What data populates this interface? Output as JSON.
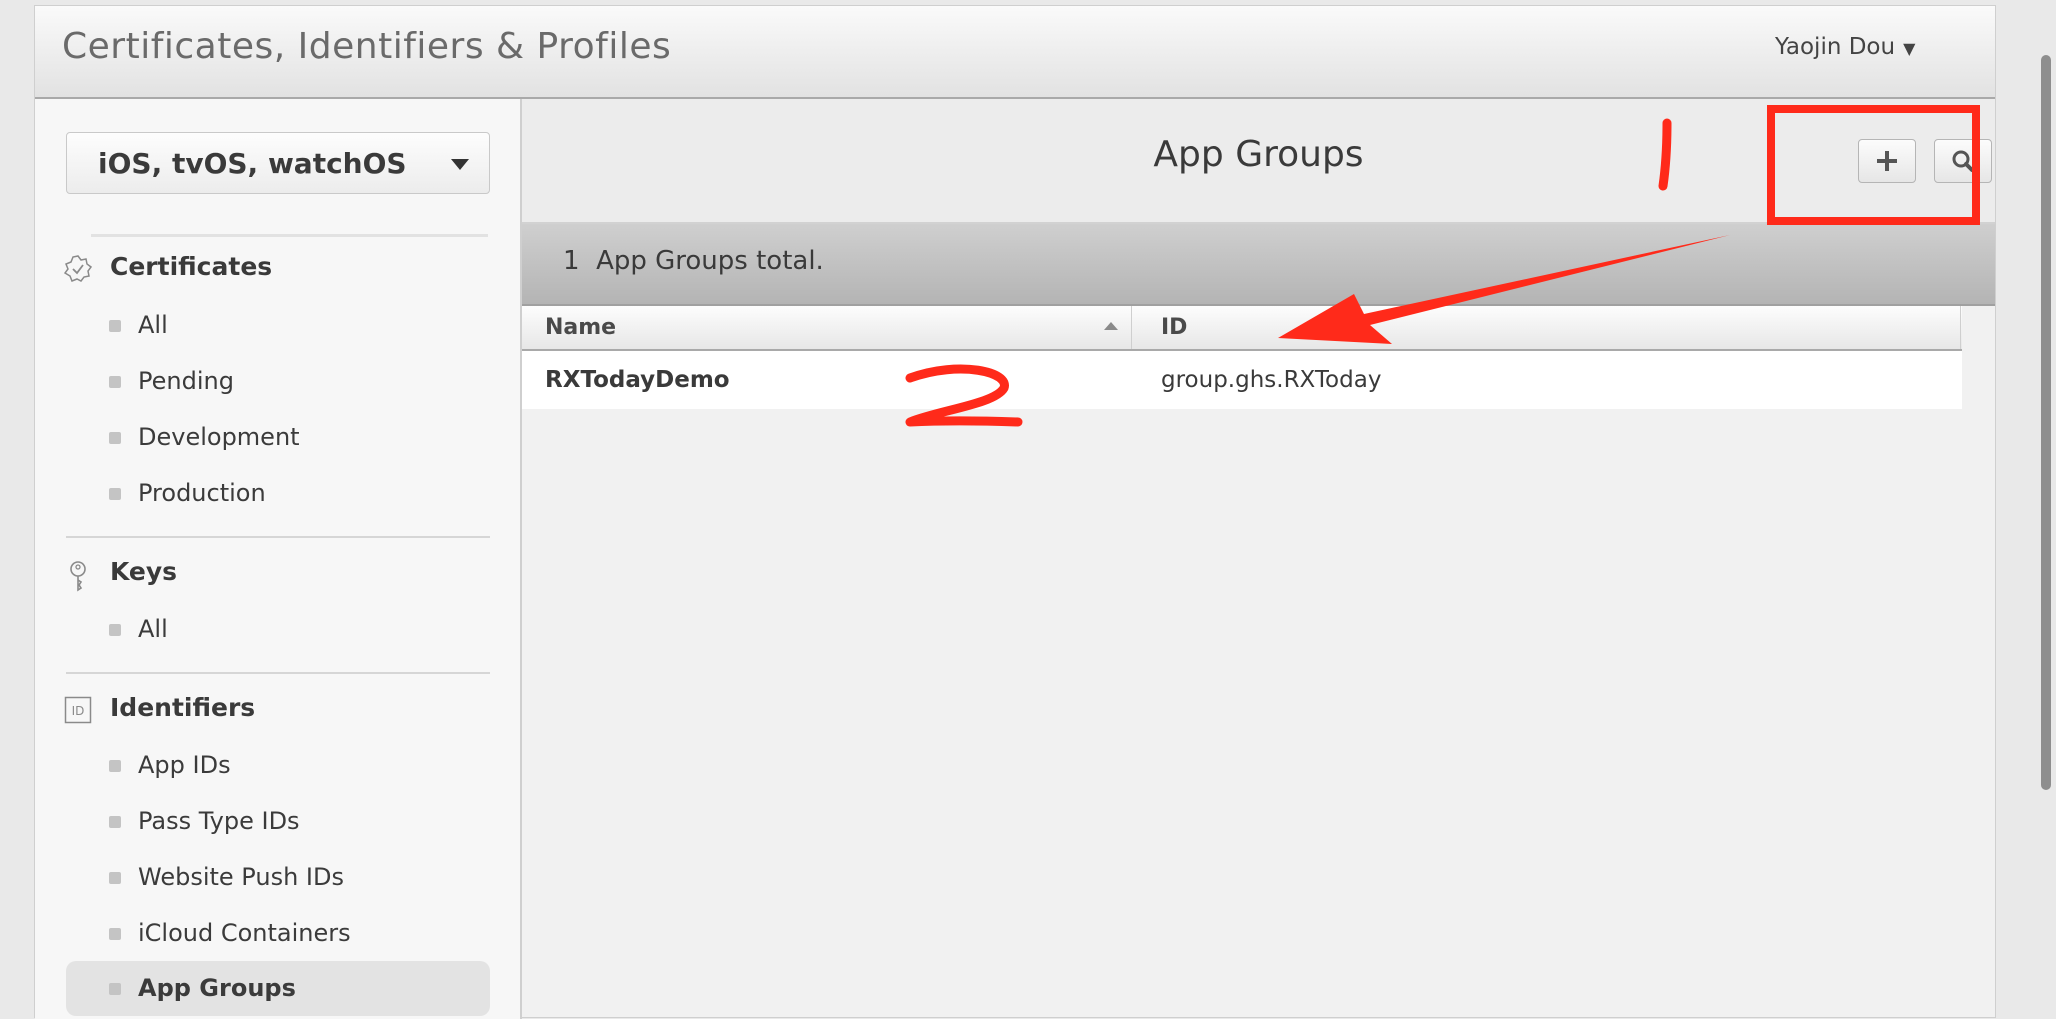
{
  "header": {
    "title": "Certificates, Identifiers & Profiles",
    "user": "Yaojin Dou"
  },
  "sidebar": {
    "platform": "iOS, tvOS, watchOS",
    "sections": [
      {
        "title": "Certificates",
        "icon": "certificate-badge-icon",
        "items": [
          {
            "label": "All"
          },
          {
            "label": "Pending"
          },
          {
            "label": "Development"
          },
          {
            "label": "Production"
          }
        ]
      },
      {
        "title": "Keys",
        "icon": "key-icon",
        "items": [
          {
            "label": "All"
          }
        ]
      },
      {
        "title": "Identifiers",
        "icon": "id-icon",
        "icon_text": "ID",
        "items": [
          {
            "label": "App IDs"
          },
          {
            "label": "Pass Type IDs"
          },
          {
            "label": "Website Push IDs"
          },
          {
            "label": "iCloud Containers"
          },
          {
            "label": "App Groups",
            "active": true
          }
        ]
      }
    ]
  },
  "content": {
    "title": "App Groups",
    "toolbar": {
      "add_icon": "plus-icon",
      "search_icon": "search-icon"
    },
    "summary": {
      "count": "1",
      "text": "App Groups total."
    },
    "table": {
      "columns": [
        {
          "label": "Name",
          "sorted": "ascending"
        },
        {
          "label": "ID"
        }
      ],
      "rows": [
        {
          "name": "RXTodayDemo",
          "id": "group.ghs.RXToday"
        }
      ]
    }
  },
  "annotations": {
    "color": "#ff2a1a",
    "marks": [
      "1",
      "2"
    ]
  }
}
